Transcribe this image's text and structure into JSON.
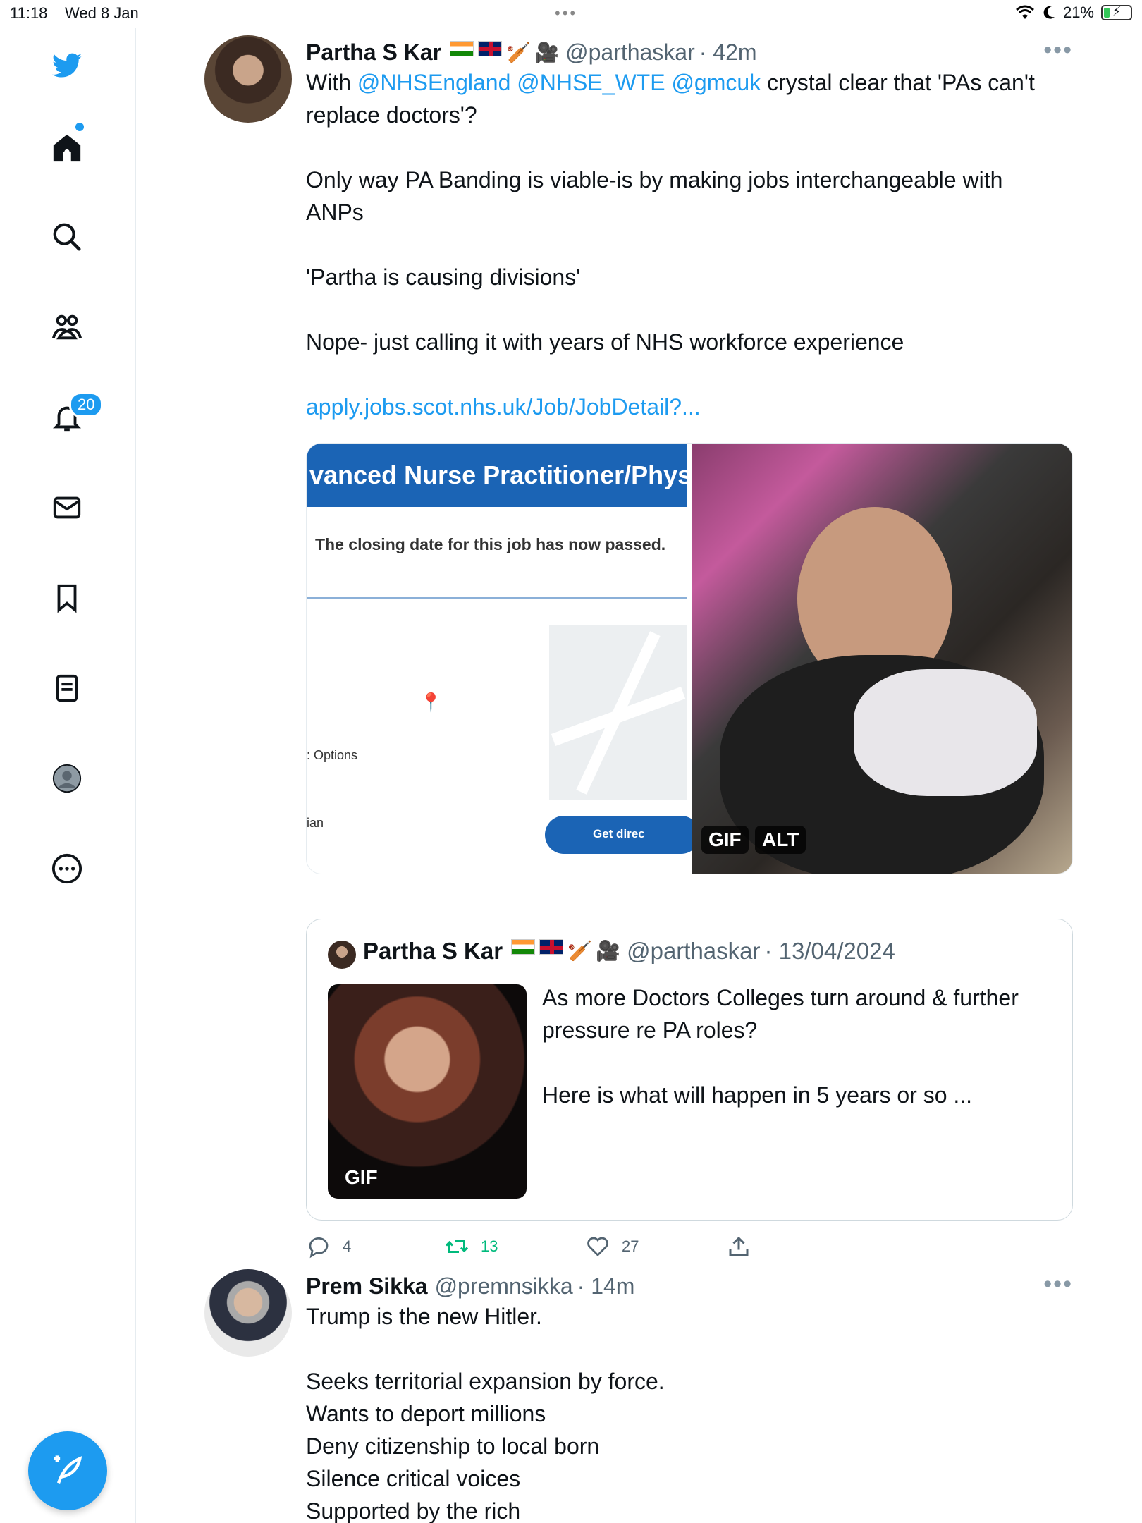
{
  "status_bar": {
    "time": "11:18",
    "date": "Wed 8 Jan",
    "battery": "21%"
  },
  "sidebar": {
    "notifications_badge": "20"
  },
  "tweets": [
    {
      "name": "Partha S Kar",
      "handle": "@parthaskar",
      "time": "· 42m",
      "text": {
        "line1_prefix": "With ",
        "mention1": "@NHSEngland",
        "mention2": "@NHSE_WTE",
        "mention3": "@gmcuk",
        "line1_suffix": " crystal clear that 'PAs can't",
        "line2": "replace doctors'?",
        "para2_line1": "Only way PA Banding is viable-is by making jobs interchangeable with",
        "para2_line2": "ANPs",
        "para3": "'Partha is causing divisions'",
        "para4": "Nope- just calling it with years of NHS workforce experience",
        "link": "apply.jobs.scot.nhs.uk/Job/JobDetail?..."
      },
      "media": {
        "banner": "vanced Nurse Practitioner/Phys",
        "closing": "The closing date for this job has now passed.",
        "options_label": ": Options",
        "ian_label": "ian",
        "get_directions": "Get direc",
        "gif_tag": "GIF",
        "alt_tag": "ALT"
      },
      "quote": {
        "name": "Partha S Kar",
        "handle": "@parthaskar",
        "date": "· 13/04/2024",
        "line1": "As more Doctors Colleges turn around & further",
        "line2": "pressure re PA roles?",
        "line3": "Here is what will happen in 5 years or so ...",
        "gif_tag": "GIF"
      },
      "actions": {
        "replies": "4",
        "retweets": "13",
        "likes": "27"
      }
    },
    {
      "name": "Prem Sikka",
      "handle": "@premnsikka",
      "time": "· 14m",
      "lines": [
        "Trump is the new Hitler.",
        "Seeks territorial expansion by force.",
        "Wants to deport millions",
        "Deny citizenship to local born",
        "Silence critical voices",
        "Supported by the rich"
      ]
    }
  ],
  "colors": {
    "accent": "#1d9bf0",
    "retweet": "#00ba7c",
    "muted": "#536471"
  }
}
